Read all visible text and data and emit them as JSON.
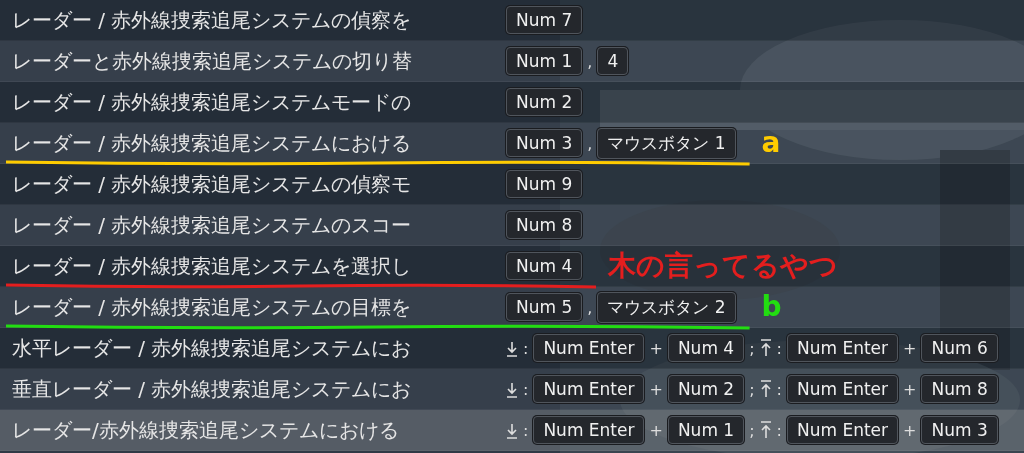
{
  "rows": [
    {
      "label": "レーダー / 赤外線捜索追尾システムの偵察を",
      "highlighted": false,
      "bindings": [
        {
          "kind": "key",
          "text": "Num 7"
        }
      ]
    },
    {
      "label": "レーダーと赤外線捜索追尾システムの切り替",
      "highlighted": false,
      "bindings": [
        {
          "kind": "key",
          "text": "Num 1"
        },
        {
          "kind": "sep",
          "text": ","
        },
        {
          "kind": "key",
          "text": "4"
        }
      ]
    },
    {
      "label": "レーダー / 赤外線捜索追尾システムモードの",
      "highlighted": false,
      "bindings": [
        {
          "kind": "key",
          "text": "Num 2"
        }
      ]
    },
    {
      "label": "レーダー / 赤外線捜索追尾システムにおける",
      "highlighted": false,
      "bindings": [
        {
          "kind": "key",
          "text": "Num 3"
        },
        {
          "kind": "sep",
          "text": ","
        },
        {
          "kind": "key",
          "text": "マウスボタン 1"
        }
      ],
      "annotation": {
        "color": "#ffcc00",
        "note": "a"
      }
    },
    {
      "label": "レーダー / 赤外線捜索追尾システムの偵察モ",
      "highlighted": false,
      "bindings": [
        {
          "kind": "key",
          "text": "Num 9"
        }
      ]
    },
    {
      "label": "レーダー / 赤外線捜索追尾システムのスコー",
      "highlighted": false,
      "bindings": [
        {
          "kind": "key",
          "text": "Num 8"
        }
      ]
    },
    {
      "label": "レーダー / 赤外線捜索追尾システムを選択し",
      "highlighted": false,
      "bindings": [
        {
          "kind": "key",
          "text": "Num 4"
        }
      ],
      "annotation": {
        "color": "#e41e1e",
        "note": "木の言ってるやつ"
      }
    },
    {
      "label": "レーダー / 赤外線捜索追尾システムの目標を",
      "highlighted": false,
      "bindings": [
        {
          "kind": "key",
          "text": "Num 5"
        },
        {
          "kind": "sep",
          "text": ","
        },
        {
          "kind": "key",
          "text": "マウスボタン 2"
        }
      ],
      "annotation": {
        "color": "#22dd11",
        "note": "b"
      }
    },
    {
      "label": "水平レーダー / 赤外線捜索追尾システムにお",
      "highlighted": false,
      "bindings": [
        {
          "kind": "down"
        },
        {
          "kind": "sep",
          "text": ":"
        },
        {
          "kind": "key",
          "text": "Num Enter"
        },
        {
          "kind": "sep",
          "text": "+"
        },
        {
          "kind": "key",
          "text": "Num 4"
        },
        {
          "kind": "sep",
          "text": ";"
        },
        {
          "kind": "up"
        },
        {
          "kind": "sep",
          "text": ":"
        },
        {
          "kind": "key",
          "text": "Num Enter"
        },
        {
          "kind": "sep",
          "text": "+"
        },
        {
          "kind": "key",
          "text": "Num 6"
        }
      ]
    },
    {
      "label": "垂直レーダー / 赤外線捜索追尾システムにお",
      "highlighted": false,
      "bindings": [
        {
          "kind": "down"
        },
        {
          "kind": "sep",
          "text": ":"
        },
        {
          "kind": "key",
          "text": "Num Enter"
        },
        {
          "kind": "sep",
          "text": "+"
        },
        {
          "kind": "key",
          "text": "Num 2"
        },
        {
          "kind": "sep",
          "text": ";"
        },
        {
          "kind": "up"
        },
        {
          "kind": "sep",
          "text": ":"
        },
        {
          "kind": "key",
          "text": "Num Enter"
        },
        {
          "kind": "sep",
          "text": "+"
        },
        {
          "kind": "key",
          "text": "Num 8"
        }
      ]
    },
    {
      "label": "レーダー/赤外線捜索追尾システムにおける",
      "highlighted": true,
      "bindings": [
        {
          "kind": "down"
        },
        {
          "kind": "sep",
          "text": ":"
        },
        {
          "kind": "key",
          "text": "Num Enter"
        },
        {
          "kind": "sep",
          "text": "+"
        },
        {
          "kind": "key",
          "text": "Num 1"
        },
        {
          "kind": "sep",
          "text": ";"
        },
        {
          "kind": "up"
        },
        {
          "kind": "sep",
          "text": ":"
        },
        {
          "kind": "key",
          "text": "Num Enter"
        },
        {
          "kind": "sep",
          "text": "+"
        },
        {
          "kind": "key",
          "text": "Num 3"
        }
      ]
    }
  ]
}
